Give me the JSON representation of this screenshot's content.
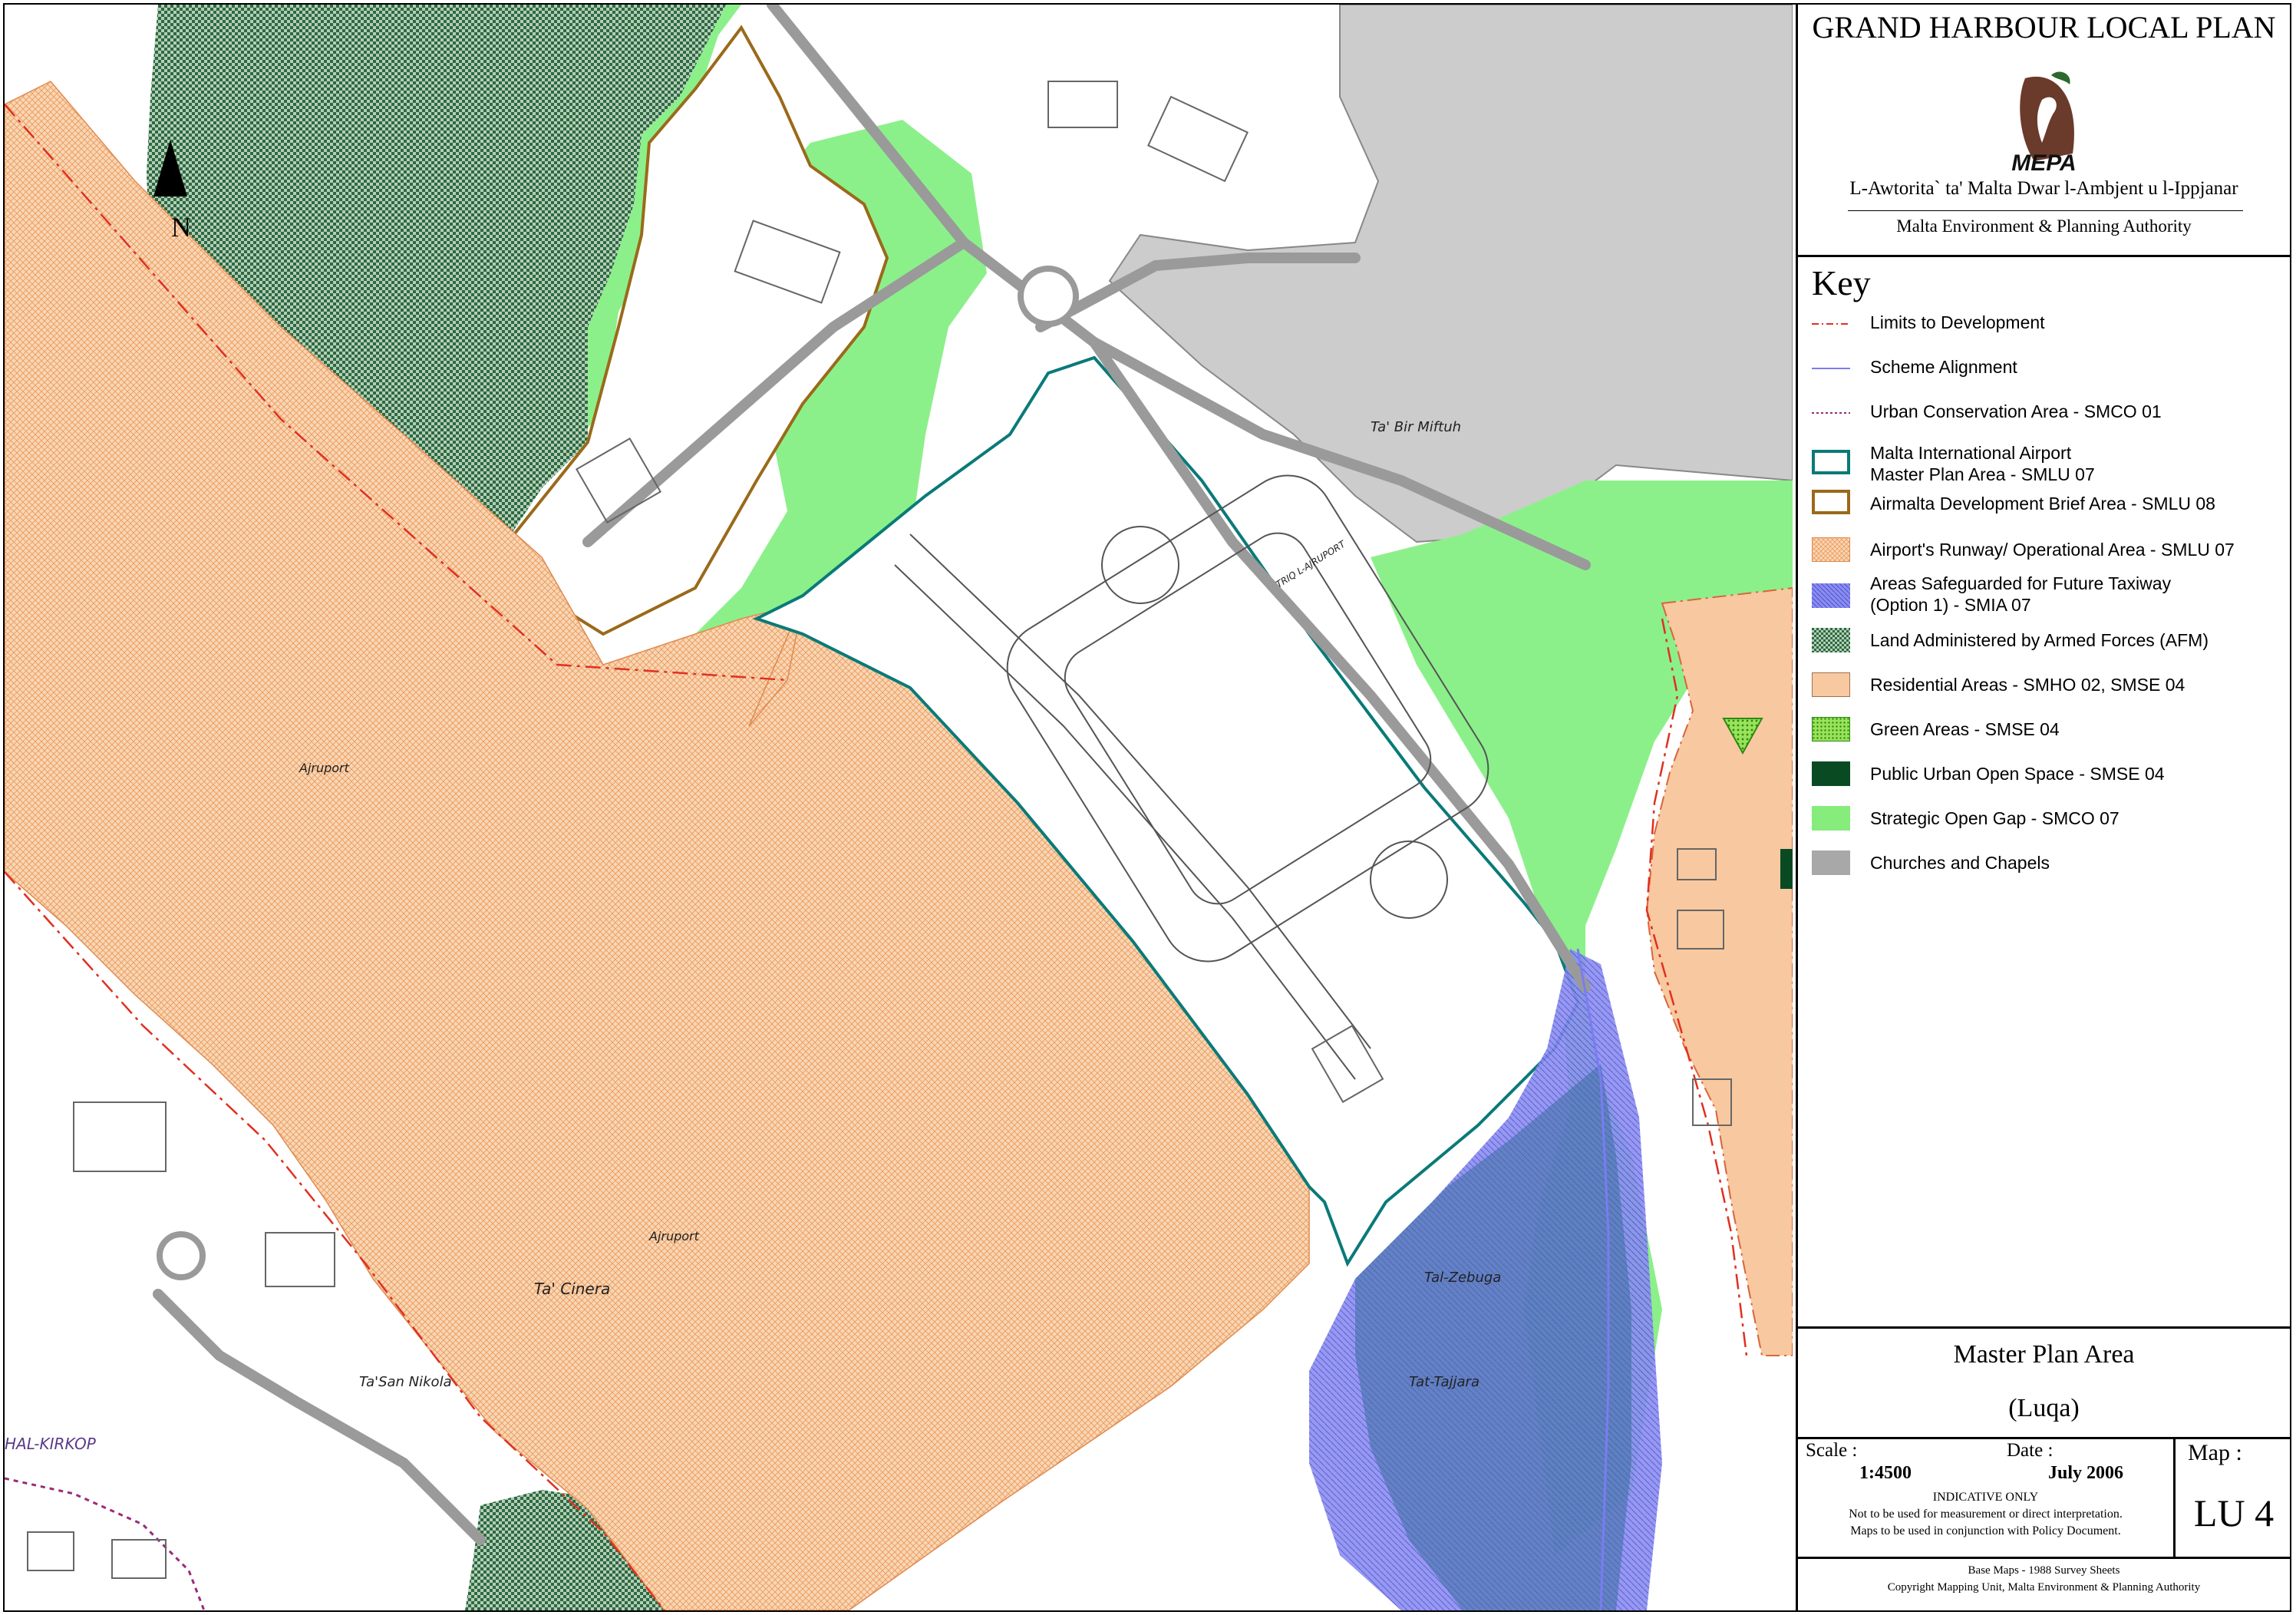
{
  "header": {
    "title": "GRAND HARBOUR LOCAL PLAN",
    "logo_text": "MEPA",
    "authority_maltese": "L-Awtorita` ta' Malta Dwar l-Ambjent u l-Ippjanar",
    "authority_english": "Malta Environment & Planning Authority"
  },
  "key": {
    "title": "Key",
    "items": [
      {
        "label": "Limits to Development",
        "swatch": "dashdot-red",
        "color": "#e03020"
      },
      {
        "label": "Scheme Alignment",
        "swatch": "line-blue",
        "color": "#7a7cf0"
      },
      {
        "label": "Urban Conservation Area - SMCO 01",
        "swatch": "dotted-purple",
        "color": "#9a2a7a"
      },
      {
        "label": "Malta International Airport\nMaster Plan Area - SMLU 07",
        "swatch": "outline-teal",
        "color": "#0a7a78"
      },
      {
        "label": "Airmalta Development Brief Area - SMLU 08",
        "swatch": "outline-brown",
        "color": "#9a6a1a"
      },
      {
        "label": "Airport's Runway/ Operational Area - SMLU 07",
        "swatch": "hatch-orange",
        "color": "#f4b887"
      },
      {
        "label": "Areas Safeguarded for Future Taxiway\n(Option 1) - SMIA 07",
        "swatch": "hatch-blue",
        "color": "#6a70e6"
      },
      {
        "label": "Land Administered by Armed Forces (AFM)",
        "swatch": "check-green",
        "color": "#2d6a40"
      },
      {
        "label": "Residential Areas - SMHO 02, SMSE 04",
        "swatch": "fill-peach",
        "color": "#f8c8a0"
      },
      {
        "label": "Green Areas - SMSE 04",
        "swatch": "dots-green",
        "color": "#4ac030"
      },
      {
        "label": "Public Urban Open Space - SMSE 04",
        "swatch": "fill-darkgreen",
        "color": "#0a4a22"
      },
      {
        "label": "Strategic Open Gap - SMCO 07",
        "swatch": "fill-lightgreen",
        "color": "#86ec7c"
      },
      {
        "label": "Churches and Chapels",
        "swatch": "fill-grey",
        "color": "#a8a8a8"
      }
    ]
  },
  "map_labels": {
    "north": "N",
    "place_bir_miftuh": "Ta' Bir Miftuh",
    "place_ajruport_1": "Ajruport",
    "place_ajruport_2": "Ajruport",
    "place_cinera": "Ta' Cinera",
    "place_san_nikola": "Ta'San Nikola",
    "place_kirkop": "HAL-KIRKOP",
    "place_zebuga": "Tal-Zebuga",
    "place_tajjara": "Tat-Tajjara",
    "road_bir_miftuh": "TRIQ L-AJRUPORT"
  },
  "panel": {
    "map_title": "Master Plan Area",
    "map_subtitle": "(Luqa)",
    "scale_label": "Scale :",
    "scale_value": "1:4500",
    "date_label": "Date :",
    "date_value": "July 2006",
    "indicative": "INDICATIVE ONLY",
    "disclaimer_1": "Not to be used for measurement or direct interpretation.",
    "disclaimer_2": "Maps to be used in conjunction with Policy Document.",
    "map_label": "Map :",
    "map_id": "LU 4",
    "footer_1": "Base Maps - 1988 Survey Sheets",
    "footer_2": "Copyright Mapping Unit, Malta Environment & Planning Authority"
  },
  "colors": {
    "runway": "#f6c8a0",
    "strategic_gap": "#8cf08a",
    "church_grey": "#c8c8c8",
    "taxiway_blue": "#7070ee",
    "airport_outline": "#0a7a78",
    "residential": "#f8c8a0"
  }
}
